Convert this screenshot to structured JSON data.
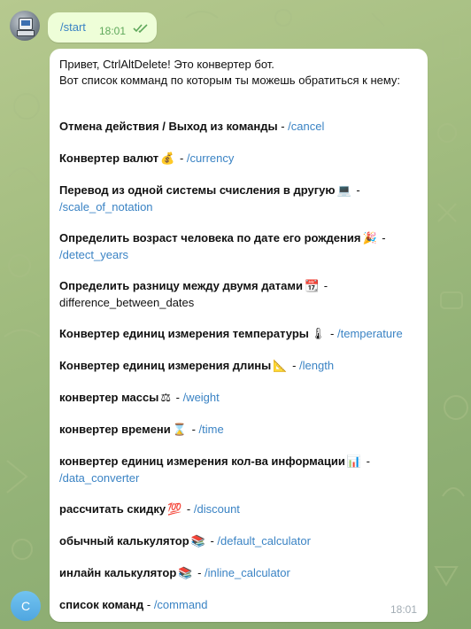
{
  "chat": {
    "outgoing": {
      "text": "/start",
      "time": "18:01"
    },
    "incoming": {
      "greeting_line1": "Привет, CtrlAltDelete! Это конвертер бот.",
      "greeting_line2": "Вот список комманд по которым ты можешь обратиться к нему:",
      "time": "18:01",
      "commands": [
        {
          "title": "Отмена действия / Выход из команды",
          "emoji": "",
          "sep": " - ",
          "cmd": "/cancel"
        },
        {
          "title": "Конвертер валют",
          "emoji": "💰",
          "sep": " - ",
          "cmd": "/currency"
        },
        {
          "title": "Перевод из одной системы счисления в другую",
          "emoji": "💻",
          "sep": " - ",
          "cmd": "/scale_of_notation"
        },
        {
          "title": "Определить возраст человека по дате его рождения",
          "emoji": "🎉",
          "sep": " - ",
          "cmd": "/detect_years"
        },
        {
          "title": "Определить разницу между двумя датами",
          "emoji": "📆",
          "sep": " - ",
          "cmd": "difference_between_dates"
        },
        {
          "title": "Конвертер единиц измерения температуры",
          "emoji": "🌡",
          "sep": " - ",
          "cmd": "/temperature"
        },
        {
          "title": "Конвертер единиц измерения длины",
          "emoji": "📐",
          "sep": " - ",
          "cmd": "/length"
        },
        {
          "title": "конвертер массы",
          "emoji": "⚖",
          "sep": " - ",
          "cmd": "/weight"
        },
        {
          "title": "конвертер времени",
          "emoji": "⌛",
          "sep": " - ",
          "cmd": "/time"
        },
        {
          "title": "конвертер единиц измерения кол-ва информации",
          "emoji": "📊",
          "sep": " - ",
          "cmd": "/data_converter"
        },
        {
          "title": "рассчитать скидку",
          "emoji": "💯",
          "sep": " - ",
          "cmd": "/discount"
        },
        {
          "title": "обычный калькулятор",
          "emoji": "📚",
          "sep": " - ",
          "cmd": "/default_calculator"
        },
        {
          "title": "инлайн калькулятор",
          "emoji": "📚",
          "sep": " - ",
          "cmd": "/inline_calculator"
        },
        {
          "title": "список команд",
          "emoji": "",
          "sep": " - ",
          "cmd": "/command"
        }
      ]
    },
    "bot_avatar_letter": "C"
  },
  "colors": {
    "link": "#3a83c4",
    "outgoing_bubble": "#eefed8",
    "incoming_bubble": "#ffffff"
  },
  "icons": {
    "read_status": "double-check-icon",
    "user_avatar": "computer-avatar-icon"
  }
}
